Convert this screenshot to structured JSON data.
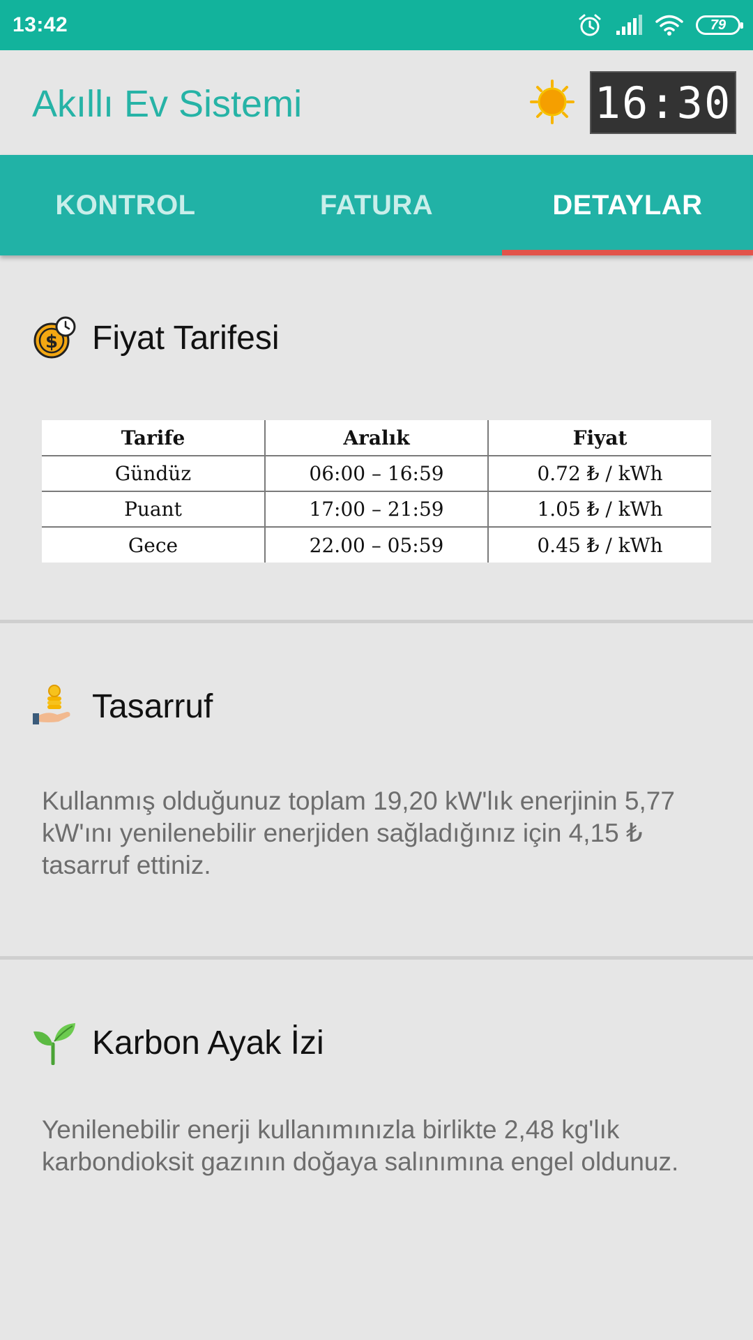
{
  "status_bar": {
    "time": "13:42",
    "battery": "79",
    "icons": [
      "alarm-icon",
      "signal-icon",
      "wifi-icon",
      "battery-icon"
    ]
  },
  "header": {
    "title": "Akıllı Ev Sistemi",
    "weather_icon": "sun-icon",
    "clock": "16:30"
  },
  "tabs": [
    {
      "label": "KONTROL",
      "active": false
    },
    {
      "label": "FATURA",
      "active": false
    },
    {
      "label": "DETAYLAR",
      "active": true
    }
  ],
  "tariff": {
    "title": "Fiyat Tarifesi",
    "icon": "coin-clock-icon",
    "columns": [
      "Tarife",
      "Aralık",
      "Fiyat"
    ],
    "rows": [
      [
        "Gündüz",
        "06:00 – 16:59",
        "0.72 ₺ / kWh"
      ],
      [
        "Puant",
        "17:00 – 21:59",
        "1.05 ₺ / kWh"
      ],
      [
        "Gece",
        "22.00 – 05:59",
        "0.45 ₺ / kWh"
      ]
    ]
  },
  "savings": {
    "title": "Tasarruf",
    "icon": "hand-coins-icon",
    "text": "Kullanmış olduğunuz toplam 19,20 kW'lık enerjinin 5,77 kW'ını yenilenebilir enerjiden sağladığınız için 4,15 ₺ tasarruf ettiniz."
  },
  "carbon": {
    "title": "Karbon Ayak İzi",
    "icon": "seedling-icon",
    "text": "Yenilenebilir enerji kullanımınızla birlikte 2,48 kg'lık karbondioksit gazının doğaya salınımına engel oldunuz."
  },
  "colors": {
    "status_bar": "#12b39c",
    "tab_bar": "#21b2a6",
    "tab_indicator": "#e2534a",
    "title_accent": "#26b3a6"
  }
}
